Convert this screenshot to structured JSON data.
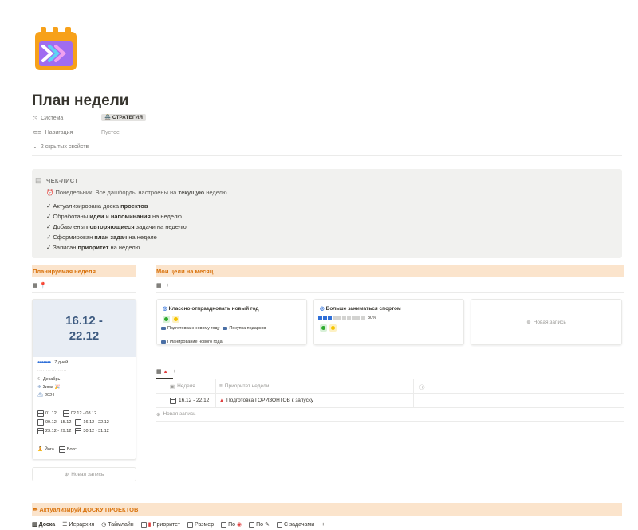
{
  "page": {
    "title": "План недели"
  },
  "properties": [
    {
      "label": "Система",
      "value": "СТРАТЕГИЯ",
      "value_emoji": "🏯"
    },
    {
      "label": "Навигация",
      "value": "Пустое"
    },
    {
      "label": "2 скрытых свойств"
    }
  ],
  "checklist": {
    "heading": "ЧЕК-ЛИСТ",
    "intro_prefix": "Понедельник:",
    "intro_mid": " Все дашборды настроены на ",
    "intro_bold": "текущую",
    "intro_end": " неделю",
    "items": [
      {
        "pre": "Актуализирована доска ",
        "bold": "проектов",
        "post": ""
      },
      {
        "pre": "Обработаны ",
        "bold": "идеи",
        "mid": " и ",
        "bold2": "напоминания",
        "post": " на неделю"
      },
      {
        "pre": "Добавлены ",
        "bold": "повторяющиеся",
        "post": " задачи на неделю"
      },
      {
        "pre": "Сформирован ",
        "bold": "план задач",
        "post": " на неделе"
      },
      {
        "pre": "Записан ",
        "bold": "приоритет",
        "post": " на неделю"
      }
    ]
  },
  "planned_week": {
    "header": "Планируемая неделя",
    "card": {
      "range": "16.12 - 22.12",
      "days_label": "7 дней",
      "month": "Декабрь",
      "season": "Зима",
      "year": "2024",
      "weeks": [
        "01.12",
        "02.12 - 08.12",
        "09.12 - 15.12",
        "16.12 - 22.12",
        "23.12 - 29.12",
        "30.12 - 31.12"
      ],
      "activity_1": "Йога",
      "activity_2": "Бокс"
    },
    "new_record": "Новая запись"
  },
  "goals": {
    "header": "Мои цели на месяц",
    "cards": [
      {
        "title": "Классно отпраздновать новый год",
        "tags": [
          "Подготовка к новому году",
          "Покупка подарков",
          "Планирование нового года"
        ]
      },
      {
        "title": "Больше заниматься спортом",
        "progress": 0.3,
        "progress_label": "30%"
      }
    ],
    "new_record": "Новая запись"
  },
  "week_table": {
    "columns": [
      "Неделя",
      "Приоритет недели"
    ],
    "rows": [
      {
        "week": "16.12 - 22.12",
        "priority": "Подготовка ГОРИЗОНТОВ к запуску"
      }
    ],
    "new_record": "Новая запись"
  },
  "projects": {
    "header": "Актуализируй ДОСКУ ПРОЕКТОВ",
    "tabs": [
      "Доска",
      "Иерархия",
      "Таймлайн",
      "Приоритет",
      "Размер",
      "По",
      "По",
      "С задачами"
    ]
  },
  "colors": {
    "accent_orange": "#d9730d",
    "section_bg": "#fbe4cc",
    "callout_bg": "#f1f1ef",
    "date_blue": "#3d5a80"
  }
}
